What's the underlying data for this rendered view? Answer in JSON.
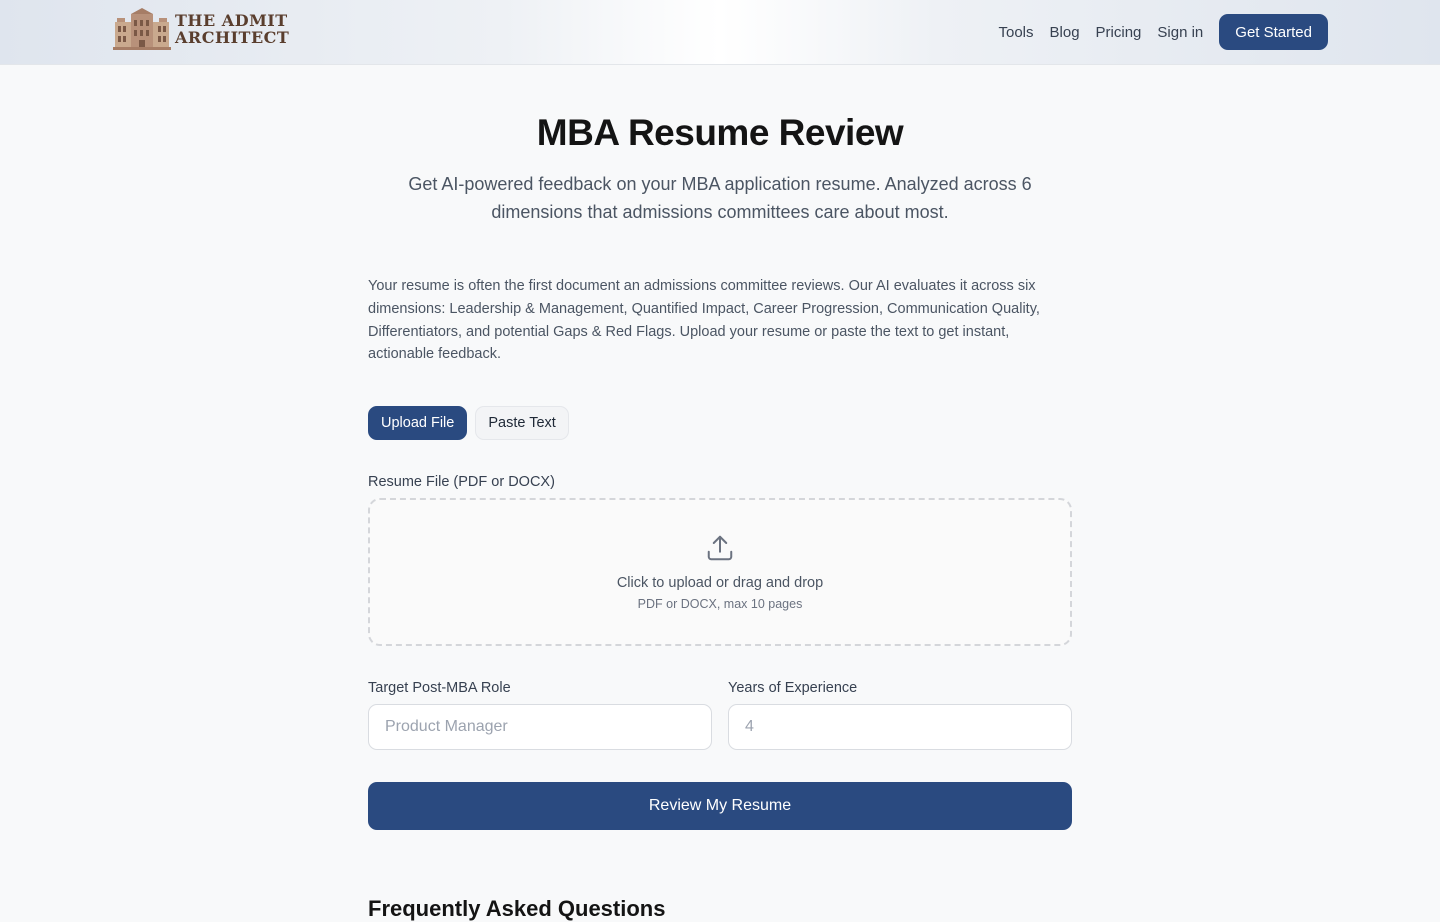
{
  "header": {
    "logo_line1": "THE ADMIT",
    "logo_line2": "ARCHITECT",
    "nav": [
      "Tools",
      "Blog",
      "Pricing",
      "Sign in"
    ],
    "cta_label": "Get Started"
  },
  "hero": {
    "title": "MBA Resume Review",
    "subtitle": "Get AI-powered feedback on your MBA application resume. Analyzed across 6 dimensions that admissions committees care about most."
  },
  "intro": "Your resume is often the first document an admissions committee reviews. Our AI evaluates it across six dimensions: Leadership & Management, Quantified Impact, Career Progression, Communication Quality, Differentiators, and potential Gaps & Red Flags. Upload your resume or paste the text to get instant, actionable feedback.",
  "tabs": {
    "upload": "Upload File",
    "paste": "Paste Text",
    "active": "upload"
  },
  "upload": {
    "label": "Resume File (PDF or DOCX)",
    "icon": "upload-icon",
    "main": "Click to upload or drag and drop",
    "sub": "PDF or DOCX, max 10 pages"
  },
  "role": {
    "label": "Target Post-MBA Role",
    "placeholder": "Product Manager",
    "value": ""
  },
  "experience": {
    "label": "Years of Experience",
    "placeholder": "4",
    "value": ""
  },
  "submit_label": "Review My Resume",
  "faq_title": "Frequently Asked Questions",
  "colors": {
    "primary": "#2a4a80",
    "logo_brown": "#5a3e2e"
  }
}
